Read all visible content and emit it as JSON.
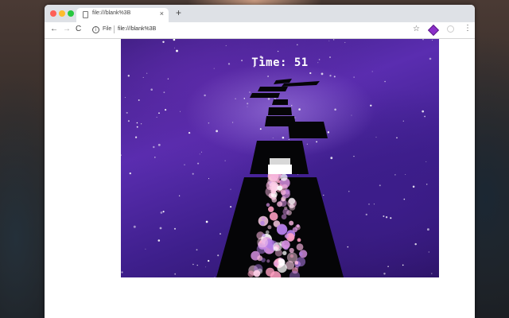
{
  "browser": {
    "tab": {
      "title": "file:///blank%3B",
      "close_glyph": "×"
    },
    "new_tab_glyph": "+",
    "nav": {
      "back_glyph": "←",
      "forward_glyph": "→",
      "reload_glyph": "C"
    },
    "address": {
      "info_glyph": "i",
      "scheme_label": "File",
      "url": "file:///blank%3B"
    },
    "toolbar_icons": {
      "star_glyph": "☆",
      "menu_glyph": "⋮"
    },
    "extensions": [
      "purple-diamond-extension-icon",
      "gray-extension-icon"
    ],
    "traffic_lights": {
      "close": "#fe5f57",
      "minimize": "#febc2e",
      "maximize": "#28c840"
    }
  },
  "game": {
    "timer_label": "Time: 51",
    "colors": {
      "sky": "#4a23a0",
      "track": "#050507",
      "player": "#ffffff",
      "trail": "#f2a6d0"
    },
    "icons": [
      "player-cube-icon",
      "particle-trail-icon"
    ]
  }
}
